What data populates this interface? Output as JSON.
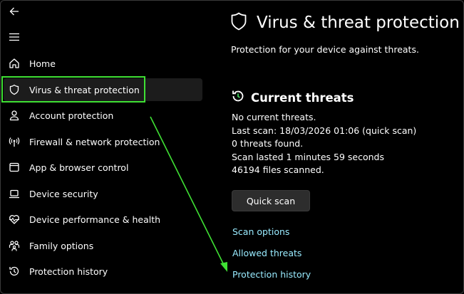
{
  "sidebar": {
    "items": [
      {
        "label": "Home",
        "icon": "home-icon"
      },
      {
        "label": "Virus & threat protection",
        "icon": "shield-icon"
      },
      {
        "label": "Account protection",
        "icon": "person-icon"
      },
      {
        "label": "Firewall & network protection",
        "icon": "antenna-icon"
      },
      {
        "label": "App & browser control",
        "icon": "app-window-icon"
      },
      {
        "label": "Device security",
        "icon": "laptop-icon"
      },
      {
        "label": "Device performance & health",
        "icon": "heart-pulse-icon"
      },
      {
        "label": "Family options",
        "icon": "family-icon"
      },
      {
        "label": "Protection history",
        "icon": "history-icon"
      }
    ]
  },
  "main": {
    "title": "Virus & threat protection",
    "subtitle": "Protection for your device against threats.",
    "current_threats": {
      "title": "Current threats",
      "lines": [
        "No current threats.",
        "Last scan: 18/03/2026 01:06 (quick scan)",
        "0 threats found.",
        "Scan lasted 1 minutes 59 seconds",
        "46194 files scanned."
      ],
      "quick_scan_label": "Quick scan"
    },
    "links": [
      "Scan options",
      "Allowed threats",
      "Protection history"
    ]
  },
  "colors": {
    "accent_link": "#99ebff",
    "highlight": "#3fe034",
    "background": "#000000"
  }
}
